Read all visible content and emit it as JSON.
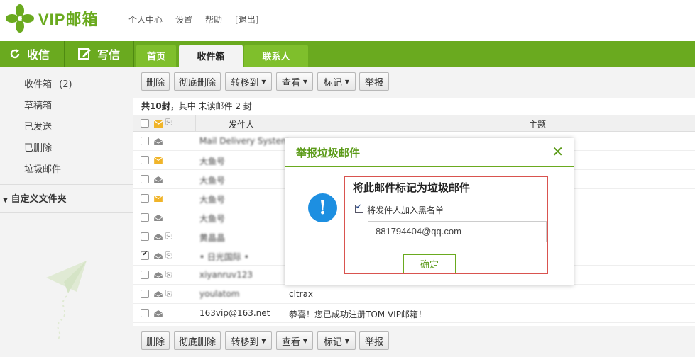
{
  "app": {
    "logo_text": "VIP邮箱"
  },
  "top_links": [
    "个人中心",
    "设置",
    "帮助",
    "[退出]"
  ],
  "actions": {
    "receive": "收信",
    "compose": "写信"
  },
  "tabs": [
    "首页",
    "收件箱",
    "联系人"
  ],
  "sidebar": {
    "items": [
      {
        "label": "收件箱",
        "count": "(2)"
      },
      {
        "label": "草稿箱"
      },
      {
        "label": "已发送"
      },
      {
        "label": "已删除"
      },
      {
        "label": "垃圾邮件"
      }
    ],
    "custom_folders": "自定义文件夹"
  },
  "toolbar": {
    "delete": "删除",
    "purge": "彻底删除",
    "move_to": "转移到",
    "view": "查看",
    "mark": "标记",
    "report": "举报"
  },
  "summary": {
    "total": "共10封",
    "mid": "，其中 ",
    "unread_label": "未读邮件",
    "unread": " 2 封"
  },
  "columns": {
    "sender": "发件人",
    "subject": "主题"
  },
  "rows": [
    {
      "sender": "Mail Delivery System",
      "subject": "",
      "blurred": true,
      "read": true,
      "attach": false,
      "checked": false
    },
    {
      "sender": "大鱼号",
      "subject": "",
      "blurred": true,
      "read": false,
      "attach": false,
      "checked": false
    },
    {
      "sender": "大鱼号",
      "subject": "",
      "blurred": true,
      "read": true,
      "attach": false,
      "checked": false
    },
    {
      "sender": "大鱼号",
      "subject": "",
      "blurred": true,
      "read": false,
      "attach": false,
      "checked": false
    },
    {
      "sender": "大鱼号",
      "subject": "",
      "blurred": true,
      "read": true,
      "attach": false,
      "checked": false
    },
    {
      "sender": "黄晶晶",
      "subject": "",
      "blurred": true,
      "read": true,
      "attach": true,
      "checked": false
    },
    {
      "sender": "• 日光国际 •",
      "subject": "",
      "blurred": true,
      "read": true,
      "attach": true,
      "checked": true
    },
    {
      "sender": "xiyanruv123",
      "subject": "",
      "blurred": true,
      "read": true,
      "attach": true,
      "checked": false
    },
    {
      "sender": "youlatom",
      "subject": "cltrax",
      "blurred": true,
      "read": true,
      "attach": true,
      "checked": false
    },
    {
      "sender": "163vip@163.net",
      "subject": "恭喜！您已成功注册TOM VIP邮箱！",
      "blurred": false,
      "read": true,
      "attach": false,
      "checked": false
    }
  ],
  "modal": {
    "title": "举报垃圾邮件",
    "close_icon": "close-icon",
    "heading": "将此邮件标记为垃圾邮件",
    "blacklist_label": "将发件人加入黑名单",
    "blacklist_checked": true,
    "address": "881794404@qq.com",
    "confirm": "确定"
  },
  "colors": {
    "brand_green": "#6aaa1f",
    "info_blue": "#1d8fe1",
    "warn_red": "#d9534f",
    "unread_yellow": "#f0b429"
  }
}
